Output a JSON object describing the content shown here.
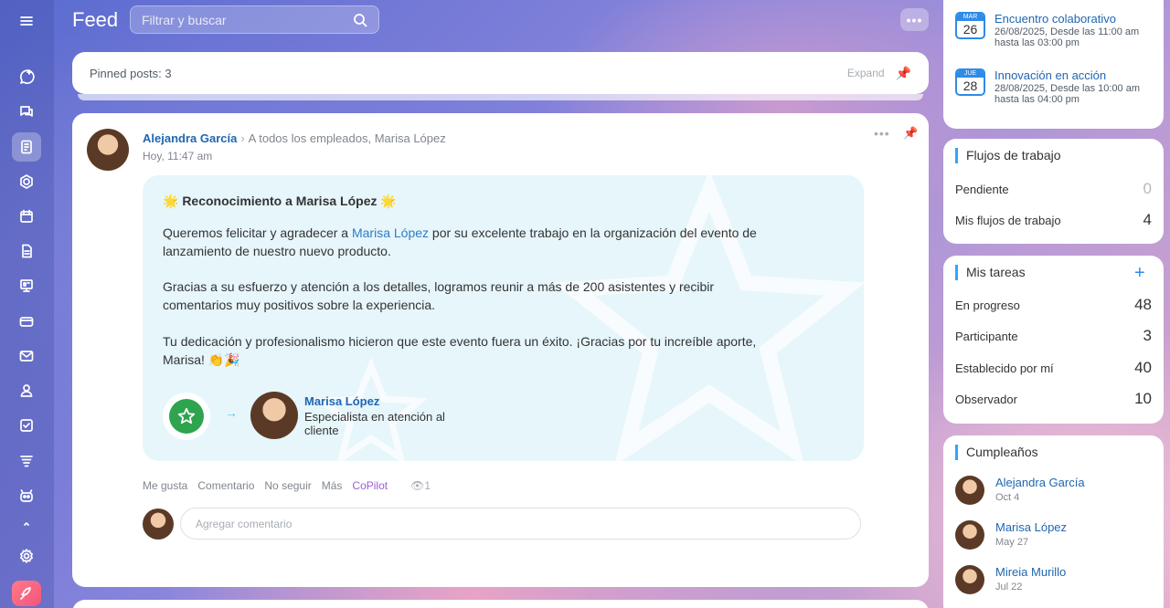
{
  "header": {
    "title": "Feed",
    "search_placeholder": "Filtrar y buscar",
    "more": "•••"
  },
  "rail": {
    "icons": [
      "menu-icon",
      "sparkle-chat-icon",
      "chat-icon",
      "feed-icon",
      "sphere-icon",
      "calendar-icon",
      "document-icon",
      "board-icon",
      "credit-card-icon",
      "mail-icon",
      "contacts-icon",
      "tasks-icon",
      "filter-icon",
      "robot-icon",
      "chevron-up-icon",
      "settings-icon",
      "rocket-icon"
    ]
  },
  "pinned": {
    "label": "Pinned posts: 3",
    "expand": "Expand"
  },
  "post": {
    "author": "Alejandra García",
    "recipients": "A todos los empleados, Marisa López",
    "time": "Hoy, 11:47 am",
    "message": {
      "title": "🌟 Reconocimiento a Marisa López 🌟",
      "p1_pre": "Queremos felicitar y agradecer a ",
      "p1_link": "Marisa López",
      "p1_post": " por su excelente trabajo en la organización del evento de lanzamiento de nuestro nuevo producto.",
      "p2": "Gracias a su esfuerzo y atención a los detalles, logramos reunir a más de 200 asistentes y recibir comentarios muy positivos sobre la experiencia.",
      "p3": "Tu dedicación y profesionalismo hicieron que este evento fuera un éxito. ¡Gracias por tu increíble aporte, Marisa! 👏🎉",
      "recipient_name": "Marisa López",
      "recipient_role": "Especialista en atención al cliente"
    },
    "actions": {
      "like": "Me gusta",
      "comment": "Comentario",
      "unfollow": "No seguir",
      "more": "Más",
      "copilot": "CoPilot",
      "views": "1"
    },
    "comment_placeholder": "Agregar comentario"
  },
  "events": [
    {
      "month": "MAR",
      "day": "26",
      "title": "Encuentro colaborativo",
      "detail": "26/08/2025, Desde las 11:00 am hasta las 03:00 pm"
    },
    {
      "month": "JUE",
      "day": "28",
      "title": "Innovación en acción",
      "detail": "28/08/2025, Desde las 10:00 am hasta las 04:00 pm"
    }
  ],
  "workflows": {
    "title": "Flujos de trabajo",
    "rows": [
      {
        "label": "Pendiente",
        "value": "0"
      },
      {
        "label": "Mis flujos de trabajo",
        "value": "4"
      }
    ]
  },
  "tasks": {
    "title": "Mis tareas",
    "add": "+",
    "rows": [
      {
        "label": "En progreso",
        "value": "48"
      },
      {
        "label": "Participante",
        "value": "3"
      },
      {
        "label": "Establecido por mí",
        "value": "40"
      },
      {
        "label": "Observador",
        "value": "10"
      }
    ]
  },
  "birthdays": {
    "title": "Cumpleaños",
    "people": [
      {
        "name": "Alejandra García",
        "date": "Oct 4"
      },
      {
        "name": "Marisa López",
        "date": "May 27"
      },
      {
        "name": "Mireia Murillo",
        "date": "Jul 22"
      }
    ]
  }
}
